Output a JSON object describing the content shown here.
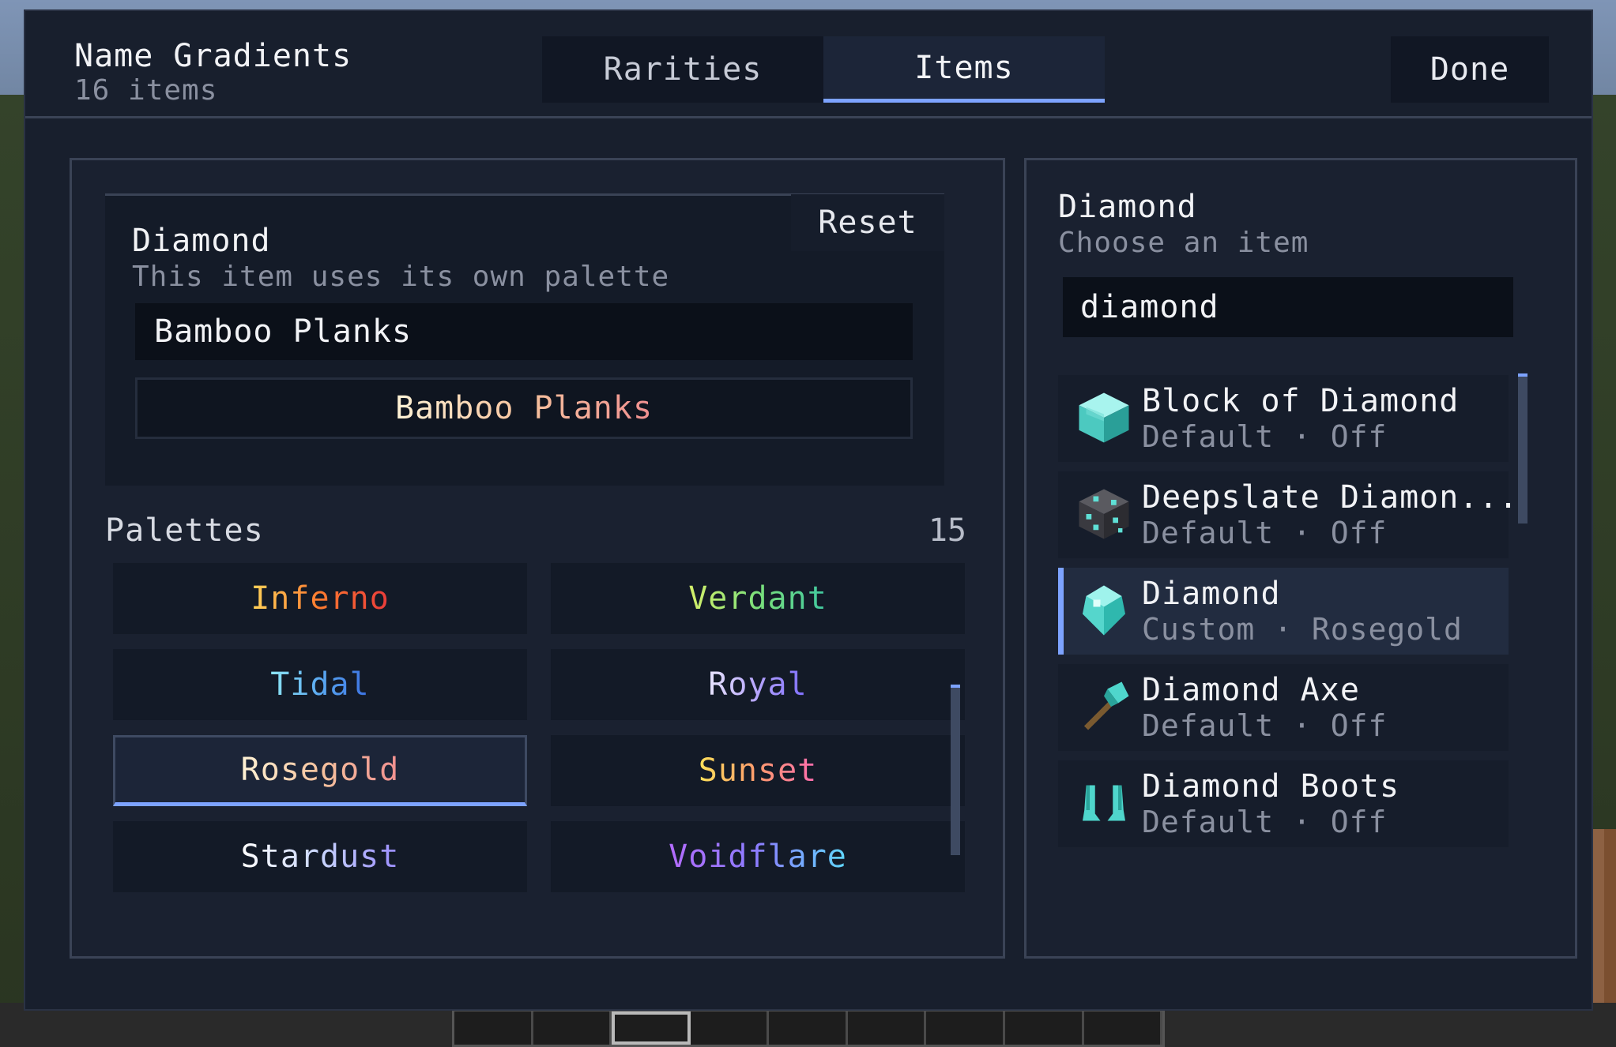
{
  "header": {
    "title": "Name Gradients",
    "subtitle": "16 items",
    "tabs": [
      {
        "label": "Rarities",
        "active": false
      },
      {
        "label": "Items",
        "active": true
      }
    ],
    "done_label": "Done"
  },
  "editor": {
    "item_name": "Diamond",
    "description": "This item uses its own palette",
    "reset_label": "Reset",
    "name_input_value": "Bamboo Planks",
    "preview_text": "Bamboo Planks"
  },
  "palettes": {
    "label": "Palettes",
    "count": "15",
    "items": [
      {
        "label": "Inferno",
        "colors": [
          "#ffd45a",
          "#ff7a2f",
          "#e83a3a"
        ],
        "selected": false
      },
      {
        "label": "Verdant",
        "colors": [
          "#d6f06a",
          "#7be07b",
          "#3fc7a0"
        ],
        "selected": false
      },
      {
        "label": "Tidal",
        "colors": [
          "#8ee6f5",
          "#5aa9f2",
          "#3a6fe0"
        ],
        "selected": false
      },
      {
        "label": "Royal",
        "colors": [
          "#e9e6ff",
          "#b5a3ff",
          "#7c6dff"
        ],
        "selected": false
      },
      {
        "label": "Rosegold",
        "colors": [
          "#fff3d6",
          "#f6c39e",
          "#f08f8f"
        ],
        "selected": true
      },
      {
        "label": "Sunset",
        "colors": [
          "#ffe15a",
          "#ff9a6e",
          "#ff6bb0"
        ],
        "selected": false
      },
      {
        "label": "Stardust",
        "colors": [
          "#ffffff",
          "#c9d6ff",
          "#9a8cff"
        ],
        "selected": false
      },
      {
        "label": "Voidflare",
        "colors": [
          "#b46bff",
          "#8b7dff",
          "#5fd8ff"
        ],
        "selected": false
      }
    ]
  },
  "item_picker": {
    "title": "Diamond",
    "subtitle": "Choose an item",
    "search_value": "diamond",
    "items": [
      {
        "name": "Block of Diamond",
        "status": "Default · Off",
        "icon": "diamond-block-icon",
        "selected": false
      },
      {
        "name": "Deepslate Diamon...",
        "status": "Default · Off",
        "icon": "deepslate-diamond-ore-icon",
        "selected": false
      },
      {
        "name": "Diamond",
        "status": "Custom · Rosegold",
        "icon": "diamond-icon",
        "selected": true
      },
      {
        "name": "Diamond Axe",
        "status": "Default · Off",
        "icon": "diamond-axe-icon",
        "selected": false
      },
      {
        "name": "Diamond Boots",
        "status": "Default · Off",
        "icon": "diamond-boots-icon",
        "selected": false
      }
    ]
  },
  "colors": {
    "accent": "#7da3ff",
    "panel_bg": "#181f2d",
    "muted_text": "#8a90a0"
  }
}
